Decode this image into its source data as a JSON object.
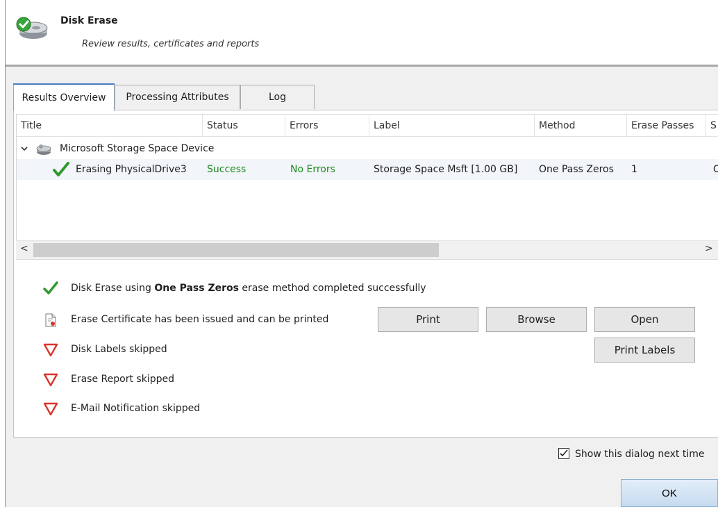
{
  "header": {
    "title": "Disk Erase",
    "subtitle": "Review results, certificates and reports"
  },
  "tabs": [
    {
      "label": "Results Overview",
      "active": true
    },
    {
      "label": "Processing Attributes",
      "active": false
    },
    {
      "label": "Log",
      "active": false
    }
  ],
  "table": {
    "columns": [
      "Title",
      "Status",
      "Errors",
      "Label",
      "Method",
      "Erase Passes",
      "S"
    ],
    "parent_row": {
      "title": "Microsoft Storage Space Device"
    },
    "rows": [
      {
        "title": "Erasing PhysicalDrive3",
        "status": "Success",
        "errors": "No Errors",
        "label": "Storage Space Msft [1.00 GB]",
        "method": "One Pass Zeros",
        "erase_passes": "1",
        "extra": "C"
      }
    ],
    "scroll_left": "<",
    "scroll_right": ">"
  },
  "results": {
    "line1_prefix": "Disk Erase using ",
    "line1_bold": "One Pass Zeros",
    "line1_suffix": " erase method completed successfully",
    "line2": "Erase Certificate has been issued and can be printed",
    "line3": "Disk Labels skipped",
    "line4": "Erase Report skipped",
    "line5": "E-Mail Notification skipped"
  },
  "buttons": {
    "print": "Print",
    "browse": "Browse",
    "open": "Open",
    "print_labels": "Print Labels",
    "ok": "OK"
  },
  "footer": {
    "show_dialog_label": "Show this dialog next time",
    "show_dialog_checked": true
  },
  "colors": {
    "success": "#1c8a1c",
    "skipped": "#d9342b",
    "accent": "#4a7bc0"
  }
}
